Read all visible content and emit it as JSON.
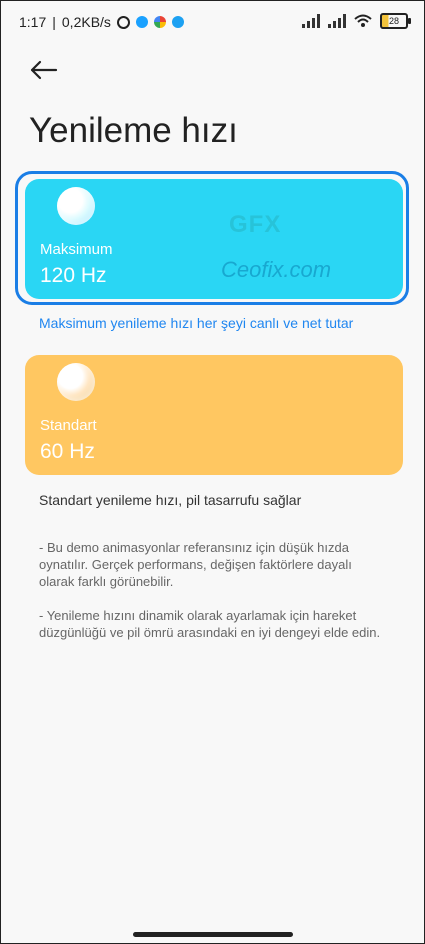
{
  "status_bar": {
    "time": "1:17",
    "speed": "0,2KB/s",
    "battery": "28"
  },
  "header": {
    "title": "Yenileme hızı"
  },
  "options": {
    "maximum": {
      "label": "Maksimum",
      "rate": "120 Hz",
      "description": "Maksimum yenileme hızı her şeyi canlı ve net tutar"
    },
    "standard": {
      "label": "Standart",
      "rate": "60 Hz",
      "description": "Standart yenileme hızı, pil tasarrufu sağlar"
    }
  },
  "notes": [
    "- Bu demo animasyonlar referansınız için düşük hızda oynatılır. Gerçek performans, değişen faktörlere dayalı olarak farklı görünebilir.",
    "- Yenileme hızını dinamik olarak ayarlamak için hareket düzgünlüğü ve pil ömrü arasındaki en iyi dengeyi elde edin."
  ],
  "watermark": {
    "logo": "GFX",
    "text": "Ceofix.com"
  },
  "colors": {
    "maximum_card": "#2ad6f4",
    "standard_card": "#ffc761",
    "selection_ring": "#1a7ee6",
    "link_text": "#1f86f0"
  },
  "icons": [
    "alarm-icon",
    "link-icon",
    "google-icon",
    "twitter-icon",
    "signal-icon",
    "wifi-icon",
    "battery-icon",
    "back-arrow-icon"
  ]
}
